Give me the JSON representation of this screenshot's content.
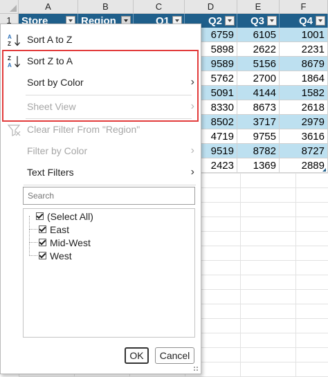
{
  "columns": [
    "A",
    "B",
    "C",
    "D",
    "E",
    "F"
  ],
  "row_numbers": [
    "1"
  ],
  "table": {
    "headers": [
      "Store",
      "Region",
      "Q1",
      "Q2",
      "Q3",
      "Q4"
    ],
    "rows": [
      [
        "6759",
        "6105",
        "1001"
      ],
      [
        "5898",
        "2622",
        "2231"
      ],
      [
        "9589",
        "5156",
        "8679"
      ],
      [
        "5762",
        "2700",
        "1864"
      ],
      [
        "5091",
        "4144",
        "1582"
      ],
      [
        "8330",
        "8673",
        "2618"
      ],
      [
        "8502",
        "3717",
        "2979"
      ],
      [
        "4719",
        "9755",
        "3616"
      ],
      [
        "9519",
        "8782",
        "8727"
      ],
      [
        "2423",
        "1369",
        "2889"
      ]
    ]
  },
  "menu": {
    "sort_a_to_z": "Sort A to Z",
    "sort_z_to_a": "Sort Z to A",
    "sort_by_color": "Sort by Color",
    "sheet_view": "Sheet View",
    "clear_filter": "Clear Filter From \"Region\"",
    "filter_by_color": "Filter by Color",
    "text_filters": "Text Filters"
  },
  "search": {
    "placeholder": "Search"
  },
  "filter_list": [
    {
      "label": "(Select All)",
      "checked": true
    },
    {
      "label": "East",
      "checked": true
    },
    {
      "label": "Mid-West",
      "checked": true
    },
    {
      "label": "West",
      "checked": true
    }
  ],
  "buttons": {
    "ok": "OK",
    "cancel": "Cancel"
  },
  "colors": {
    "header_fill": "#1f5f8b",
    "band_fill": "#bde0f0",
    "highlight": "#e23b3b"
  }
}
